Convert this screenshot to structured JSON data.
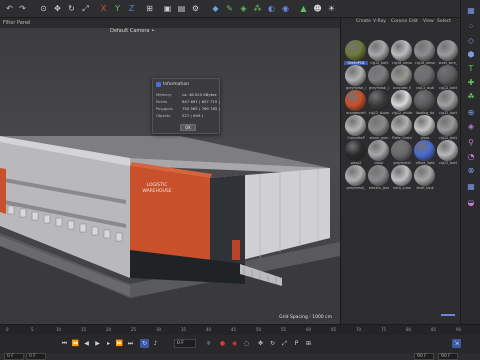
{
  "menubar": {
    "items": [
      "Filter",
      "Panel"
    ]
  },
  "viewport": {
    "camera_label": "Default Camera •·",
    "grid_spacing": "Grid Spacing : 1000 cm",
    "building_sign": "LOGISTIC WAREHOUSE"
  },
  "dialog": {
    "title": "Information",
    "rows": [
      {
        "label": "Memory",
        "value": "ca. 48.525 KBytes"
      },
      {
        "label": "Points",
        "value": "647 697 ( 657 715 )"
      },
      {
        "label": "Polygons",
        "value": "750 585 ( 769 785 )"
      },
      {
        "label": "Objects",
        "value": "227 ( 649 )"
      }
    ],
    "ok_label": "OK"
  },
  "material_panel": {
    "menu": [
      "Create",
      "V-Ray",
      "Corona",
      "Edit",
      "View",
      "Select"
    ],
    "materials": [
      {
        "label": "GreenPCB",
        "color": "#6b7a3a",
        "selected": true
      },
      {
        "label": "clg12_bott",
        "color": "#a8a8aa"
      },
      {
        "label": "clg16_alesa",
        "color": "#bcbcbe"
      },
      {
        "label": "clg16_alesa",
        "color": "#8e8e90"
      },
      {
        "label": "steel_wire_",
        "color": "#9c9c9e"
      },
      {
        "label": "greymetal_l",
        "color": "#b0b0b2"
      },
      {
        "label": "greymetal_l",
        "color": "#7c7c7e"
      },
      {
        "label": "concrete_fl",
        "color": "#9a9894"
      },
      {
        "label": "clg13_stub",
        "color": "#6e6e70"
      },
      {
        "label": "clg12_bott",
        "color": "#5e5e60"
      },
      {
        "label": "orangemetl",
        "color": "#c8502a"
      },
      {
        "label": "clg12_bluep",
        "color": "#3a3a3c"
      },
      {
        "label": "clg12_white",
        "color": "#d8d8da"
      },
      {
        "label": "loading_do",
        "color": "#5a5a5c"
      },
      {
        "label": "clg12_bott",
        "color": "#a0a0a2"
      },
      {
        "label": "ConcreteP",
        "color": "#b4b4b2"
      },
      {
        "label": "stone_gran",
        "color": "#8a8a8c"
      },
      {
        "label": "Plate_Grate",
        "color": "#b0b0b0"
      },
      {
        "label": "glass",
        "color": "#c4c4c6"
      },
      {
        "label": "clg12_bott",
        "color": "#9a9a9c"
      },
      {
        "label": "glass2",
        "color": "#2a2a2c"
      },
      {
        "label": "clolor",
        "color": "#a8a8aa"
      },
      {
        "label": "greymetal",
        "color": "#6a6a6c"
      },
      {
        "label": "offset_light",
        "color": "#4a6ad0"
      },
      {
        "label": "clg12_bott",
        "color": "#b8b8ba"
      },
      {
        "label": "greymetal_",
        "color": "#b0b0b2"
      },
      {
        "label": "electric_box",
        "color": "#8a8a8c"
      },
      {
        "label": "vent_cube",
        "color": "#c0c0c2"
      },
      {
        "label": "shelf_tank",
        "color": "#a6a6a8"
      },
      {
        "label": "",
        "color": "#2d2d2f"
      }
    ]
  },
  "timeline": {
    "ruler": [
      "0",
      "5",
      "10",
      "15",
      "20",
      "25",
      "30",
      "35",
      "40",
      "45",
      "50",
      "55",
      "60",
      "65",
      "70",
      "75",
      "80",
      "85",
      "90"
    ],
    "current_frame": "0 F",
    "start_frame": "0 F",
    "end_frame": "90 F",
    "max_frame": "90 F"
  },
  "colors": {
    "accent": "#3c58a8",
    "orange_facade": "#c8502a",
    "record_red": "#d83a3a"
  }
}
